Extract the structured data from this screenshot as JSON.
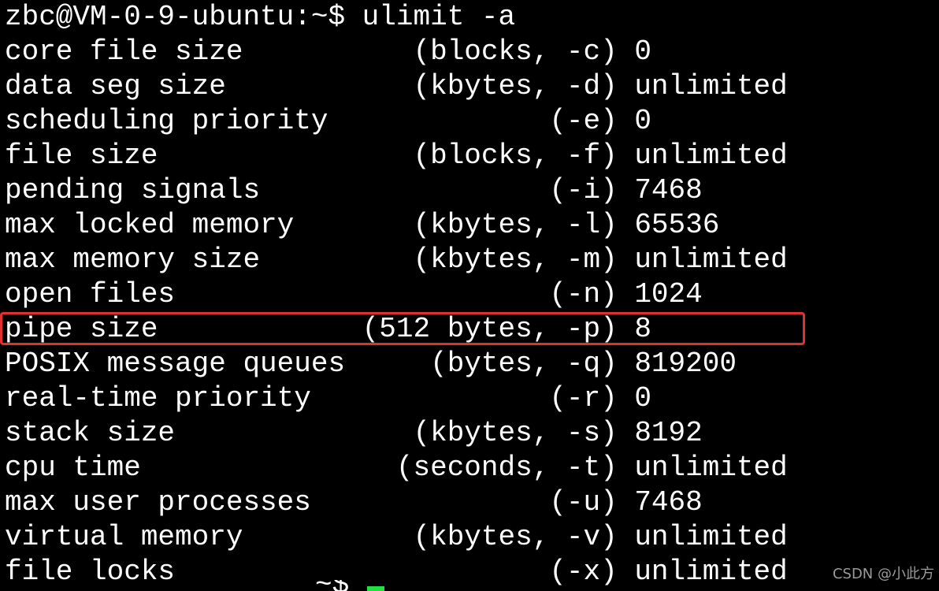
{
  "terminal": {
    "prompt": "zbc@VM-0-9-ubuntu:~$ ulimit -a",
    "highlight_color": "#e03030",
    "cursor_color": "#22e040",
    "lines": [
      "core file size          (blocks, -c) 0",
      "data seg size           (kbytes, -d) unlimited",
      "scheduling priority             (-e) 0",
      "file size               (blocks, -f) unlimited",
      "pending signals                 (-i) 7468",
      "max locked memory       (kbytes, -l) 65536",
      "max memory size         (kbytes, -m) unlimited",
      "open files                      (-n) 1024",
      "pipe size            (512 bytes, -p) 8",
      "POSIX message queues     (bytes, -q) 819200",
      "real-time priority              (-r) 0",
      "stack size              (kbytes, -s) 8192",
      "cpu time               (seconds, -t) unlimited",
      "max user processes              (-u) 7468",
      "virtual memory          (kbytes, -v) unlimited",
      "file locks                      (-x) unlimited"
    ],
    "next_prompt_partial": "~$"
  },
  "watermark": "CSDN @小此方"
}
